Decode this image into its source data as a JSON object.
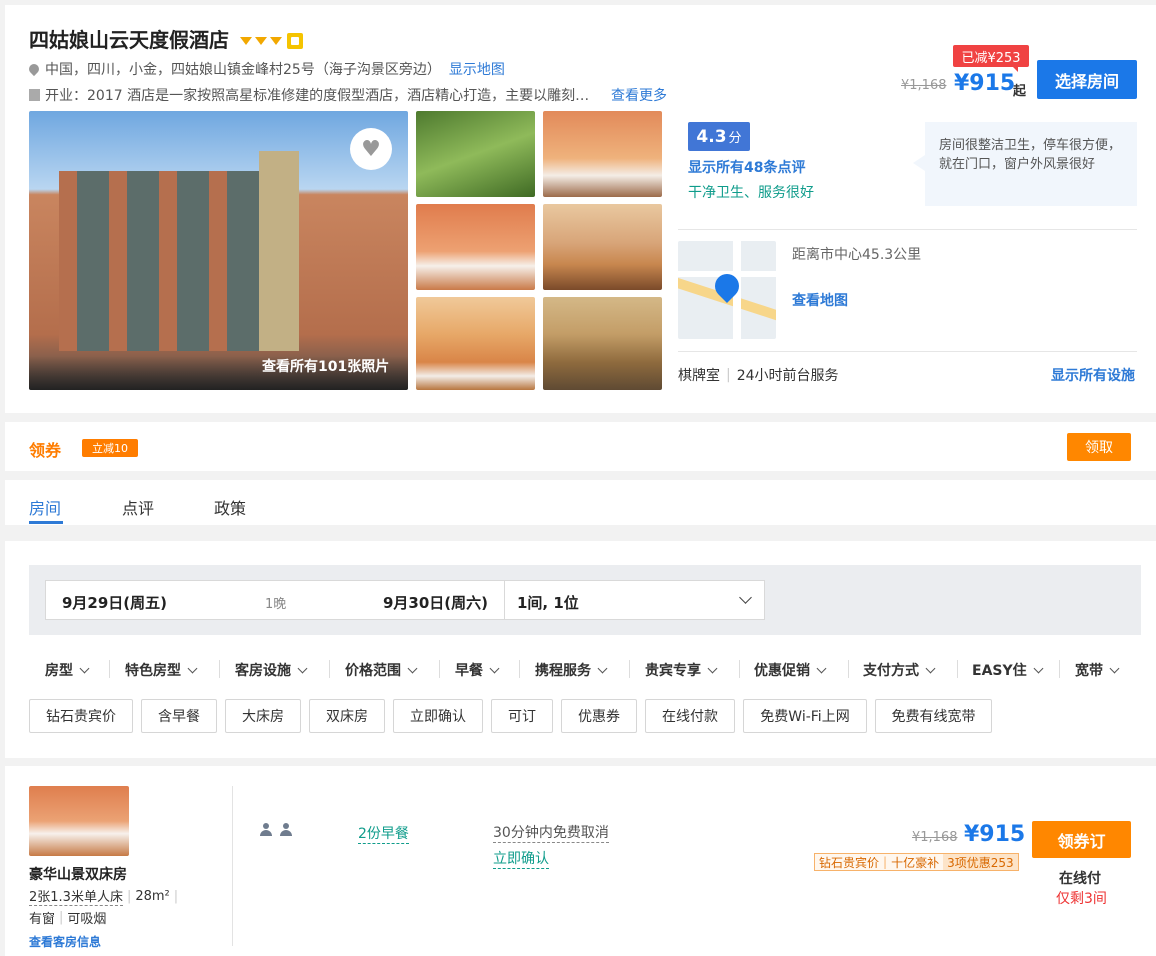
{
  "hotel": {
    "name": "四姑娘山云天度假酒店",
    "address": "中国，四川，小金，四姑娘山镇金峰村25号（海子沟景区旁边）",
    "show_map": "显示地图",
    "desc": "开业：2017  酒店是一家按照高星标准修建的度假型酒店，酒店精心打造，主要以雕刻…",
    "more": "查看更多",
    "discount_badge": "已减¥253",
    "orig_price": "¥1,168",
    "price": "¥915",
    "price_suffix": "起",
    "select_room": "选择房间",
    "photos_label": "查看所有101张照片",
    "score": "4.3",
    "score_unit": "分",
    "reviews_link": "显示所有48条点评",
    "review_tags": "干净卫生、服务很好",
    "review_quote": "房间很整洁卫生，停车很方便，就在门口，窗户外风景很好",
    "distance": "距离市中心45.3公里",
    "view_map": "查看地图",
    "facility_1": "棋牌室",
    "facility_2": "24小时前台服务",
    "show_facilities": "显示所有设施"
  },
  "coupon": {
    "label": "领券",
    "badge": "立减10",
    "button": "领取"
  },
  "tabs": [
    "房间",
    "点评",
    "政策"
  ],
  "search": {
    "checkin": "9月29日(周五)",
    "nights": "1晚",
    "checkout": "9月30日(周六)",
    "guests": "1间, 1位"
  },
  "filters": [
    "房型",
    "特色房型",
    "客房设施",
    "价格范围",
    "早餐",
    "携程服务",
    "贵宾专享",
    "优惠促销",
    "支付方式",
    "EASY住",
    "宽带"
  ],
  "tags": [
    "钻石贵宾价",
    "含早餐",
    "大床房",
    "双床房",
    "立即确认",
    "可订",
    "优惠券",
    "在线付款",
    "免费Wi-Fi上网",
    "免费有线宽带"
  ],
  "room": {
    "name": "豪华山景双床房",
    "bed": "2张1.3米单人床",
    "area": "28m²",
    "window": "有窗",
    "smoking": "可吸烟",
    "info_link": "查看客房信息",
    "breakfast": "2份早餐",
    "cancel": "30分钟内免费取消",
    "confirm": "立即确认",
    "orig_price": "¥1,168",
    "price": "¥915",
    "promo_1": "钻石贵宾价",
    "promo_2": "十亿豪补",
    "promo_3": "3项优惠253",
    "book": "领券订",
    "pay": "在线付",
    "left": "仅剩3间"
  }
}
